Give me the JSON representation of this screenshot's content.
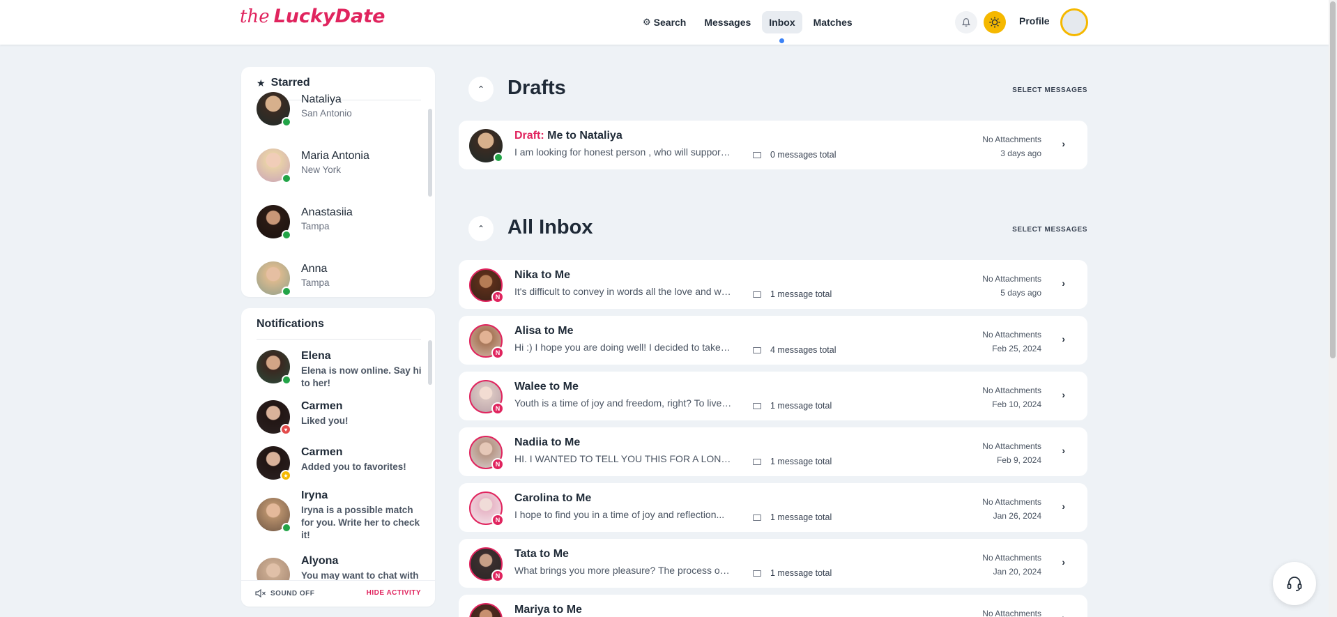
{
  "header": {
    "logo_the": "the",
    "logo_main": "LuckyDate",
    "nav": [
      {
        "label": "Search"
      },
      {
        "label": "Messages"
      },
      {
        "label": "Inbox"
      },
      {
        "label": "Matches"
      }
    ],
    "profile_label": "Profile",
    "active_nav": "Inbox"
  },
  "starred": {
    "title": "Starred",
    "items": [
      {
        "name": "Nataliya",
        "city": "San Antonio"
      },
      {
        "name": "Maria Antonia",
        "city": "New York"
      },
      {
        "name": "Anastasiia",
        "city": "Tampa"
      },
      {
        "name": "Anna",
        "city": "Tampa"
      }
    ]
  },
  "notifications": {
    "title": "Notifications",
    "items": [
      {
        "name": "Elena",
        "text": "Elena is now online. Say hi to her!"
      },
      {
        "name": "Carmen",
        "text": "Liked you!"
      },
      {
        "name": "Carmen",
        "text": "Added you to favorites!"
      },
      {
        "name": "Iryna",
        "text": "Iryna is a possible match for you. Write her to check it!"
      },
      {
        "name": "Alyona",
        "text": "You may want to chat with"
      }
    ],
    "sound_label": "SOUND OFF",
    "hide_label": "HIDE ACTIVITY"
  },
  "drafts": {
    "title": "Drafts",
    "select_label": "SELECT MESSAGES",
    "items": [
      {
        "prefix": "Draft:",
        "title": "Me to Nataliya",
        "preview": "I am looking for honest person , who will support me",
        "count": "0 messages total",
        "attachments": "No Attachments",
        "date": "3 days ago"
      }
    ]
  },
  "inbox": {
    "title": "All Inbox",
    "select_label": "SELECT MESSAGES",
    "badge": "N",
    "items": [
      {
        "title": "Nika to Me",
        "preview": "It's difficult to convey in words all the love and warmth",
        "count": "1 message total",
        "attachments": "No Attachments",
        "date": "5 days ago"
      },
      {
        "title": "Alisa to Me",
        "preview": "Hi :) I hope you are doing well! I decided to take a chance",
        "count": "4 messages total",
        "attachments": "No Attachments",
        "date": "Feb 25, 2024"
      },
      {
        "title": "Walee to Me",
        "preview": "Youth is a time of joy and freedom, right? To live it fully",
        "count": "1 message total",
        "attachments": "No Attachments",
        "date": "Feb 10, 2024"
      },
      {
        "title": "Nadiia to Me",
        "preview": "HI. I WANTED TO TELL YOU THIS FOR A LONG TIME",
        "count": "1 message total",
        "attachments": "No Attachments",
        "date": "Feb 9, 2024"
      },
      {
        "title": "Carolina to Me",
        "preview": "I hope to find you in a time of joy and reflection...",
        "count": "1 message total",
        "attachments": "No Attachments",
        "date": "Jan 26, 2024"
      },
      {
        "title": "Tata to Me",
        "preview": "What brings you more pleasure? The process of creating",
        "count": "1 message total",
        "attachments": "No Attachments",
        "date": "Jan 20, 2024"
      },
      {
        "title": "Mariya to Me",
        "preview": "",
        "count": "",
        "attachments": "No Attachments",
        "date": ""
      }
    ]
  },
  "colors": {
    "brand": "#e0245e",
    "online": "#22a447",
    "accent": "#f5b800",
    "active_dot": "#3b82f6"
  }
}
